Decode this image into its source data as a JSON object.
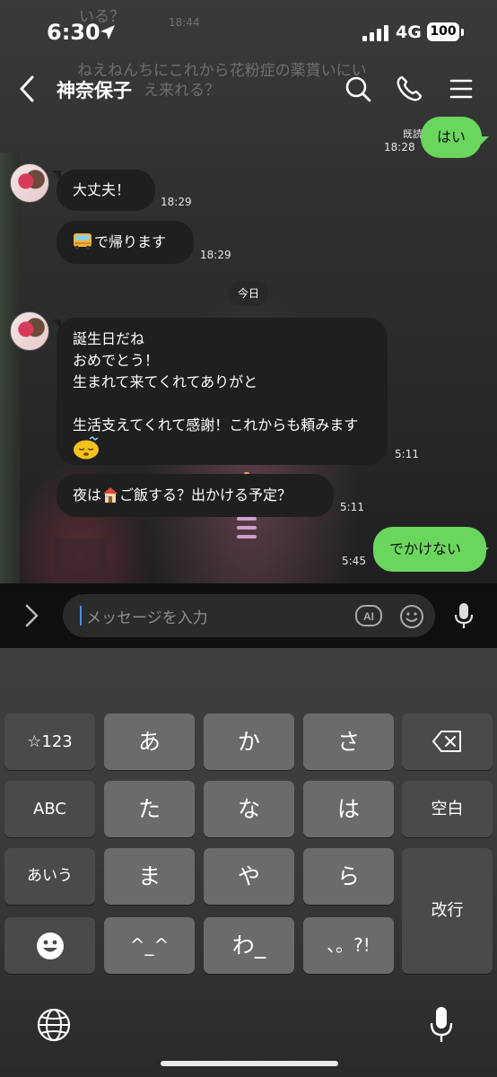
{
  "status_bar": {
    "time": "6:30",
    "network": "4G",
    "battery": "100"
  },
  "background_texts": [
    "いる？",
    "18:44",
    "ねえねんちにこれから花粉症の薬貰いにい",
    "え来れる？"
  ],
  "header": {
    "title": "神奈保子"
  },
  "messages": [
    {
      "side": "out",
      "lines": [
        "はい"
      ],
      "read": "既読",
      "time": "18:28"
    },
    {
      "side": "in",
      "lines": [
        "大丈夫！"
      ],
      "time": "18:29"
    },
    {
      "side": "in",
      "lines": [
        "で帰ります"
      ],
      "emoji": "bus",
      "time": "18:29"
    },
    {
      "side": "in",
      "lines": [
        "誕生日だね",
        "おめでとう！",
        "生まれて来てくれてありがと",
        "",
        "生活支えてくれて感謝！これからも頼みます"
      ],
      "emoji": "sleepy-face",
      "time": "5:11"
    },
    {
      "side": "in",
      "lines": [
        "夜は",
        "ご飯する？出かける予定？"
      ],
      "emoji": "house",
      "time": "5:11"
    },
    {
      "side": "out",
      "lines": [
        "でかけない"
      ],
      "time": "5:45"
    }
  ],
  "date_separator": "今日",
  "input": {
    "placeholder": "メッセージを入力",
    "ai_label": "AI"
  },
  "keyboard": {
    "keys": {
      "sym": "☆123",
      "a": "あ",
      "ka": "か",
      "sa": "さ",
      "abc": "ABC",
      "ta": "た",
      "na": "な",
      "ha": "は",
      "space": "空白",
      "aiu": "あいう",
      "ma": "ま",
      "ya": "や",
      "ra": "ら",
      "enter": "改行",
      "kaomoji": "^_^",
      "wa": "わ_",
      "punct": "、。?!"
    }
  },
  "colors": {
    "outgoing_bubble": "#6bd65e",
    "incoming_bubble": "#1f1f1f",
    "caret": "#4a8cff"
  }
}
